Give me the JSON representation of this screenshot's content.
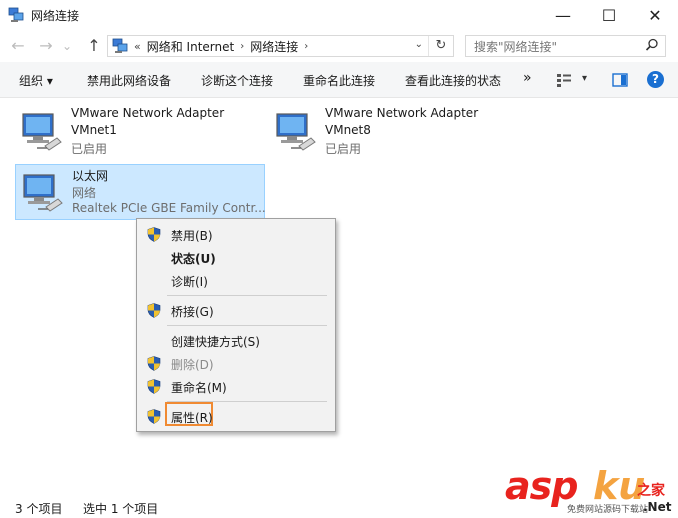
{
  "window": {
    "title": "网络连接",
    "minimize": "—",
    "maximize": "☐",
    "close": "✕"
  },
  "address_bar": {
    "back": "←",
    "forward": "→",
    "recent": "⌄",
    "up": "↑",
    "overflow": "«",
    "crumbs": [
      "网络和 Internet",
      "网络连接"
    ],
    "refresh": "↻",
    "search_placeholder": "搜索\"网络连接\""
  },
  "toolbar": {
    "organize": "组织 ▾",
    "disable": "禁用此网络设备",
    "diagnose": "诊断这个连接",
    "rename": "重命名此连接",
    "status": "查看此连接的状态",
    "more": "»",
    "help": "?"
  },
  "adapters": [
    {
      "line1": "VMware Network Adapter",
      "line2": "VMnet1",
      "line3": "已启用",
      "selected": false
    },
    {
      "line1": "VMware Network Adapter",
      "line2": "VMnet8",
      "line3": "已启用",
      "selected": false
    },
    {
      "line1": "以太网",
      "line2": "网络",
      "line3": "Realtek PCIe GBE Family Contr...",
      "selected": true
    }
  ],
  "context_menu": {
    "items": [
      {
        "label": "禁用(B)",
        "shield": true
      },
      {
        "label": "状态(U)",
        "bold": true
      },
      {
        "label": "诊断(I)"
      },
      {
        "label": "桥接(G)",
        "shield": true
      },
      {
        "label": "创建快捷方式(S)"
      },
      {
        "label": "删除(D)",
        "shield": true,
        "disabled": true
      },
      {
        "label": "重命名(M)",
        "shield": true
      },
      {
        "label": "属性(R)",
        "shield": true,
        "highlighted": true
      }
    ]
  },
  "status_bar": {
    "count": "3 个项目",
    "selection": "选中 1 个项目"
  },
  "watermark": {
    "asp": "asp",
    "ku": "ku",
    "cn": "之家",
    "sub": "免费网站源码下载站",
    "net": ".Net"
  },
  "colors": {
    "selection_bg": "#cce8ff",
    "selection_border": "#99d1ff",
    "menu_bg": "#f2f2f2",
    "highlight_box": "#f08a32",
    "help_blue": "#1a6fd1"
  }
}
